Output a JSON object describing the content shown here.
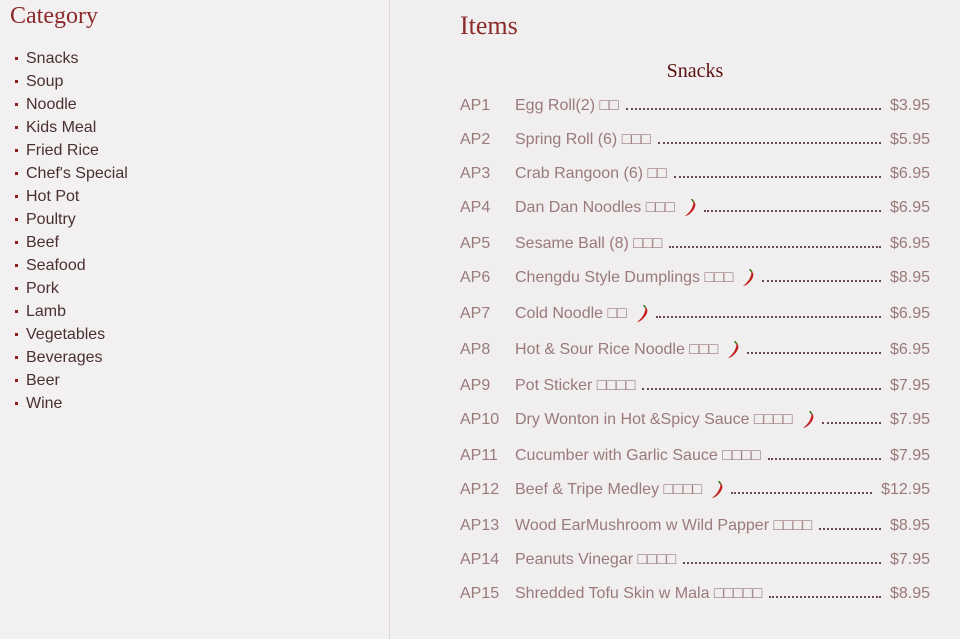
{
  "sidebar": {
    "title": "Category",
    "items": [
      "Snacks",
      "Soup",
      "Noodle",
      "Kids Meal",
      "Fried Rice",
      "Chef's Special",
      "Hot Pot",
      "Poultry",
      "Beef",
      "Seafood",
      "Pork",
      "Lamb",
      "Vegetables",
      "Beverages",
      "Beer",
      "Wine"
    ]
  },
  "main": {
    "title": "Items",
    "section": "Snacks",
    "items": [
      {
        "code": "AP1",
        "name": "Egg Roll(2) □□",
        "price": "$3.95",
        "spicy": false
      },
      {
        "code": "AP2",
        "name": "Spring Roll (6) □□□",
        "price": "$5.95",
        "spicy": false
      },
      {
        "code": "AP3",
        "name": "Crab Rangoon (6) □□",
        "price": "$6.95",
        "spicy": false
      },
      {
        "code": "AP4",
        "name": "Dan Dan Noodles □□□",
        "price": "$6.95",
        "spicy": true
      },
      {
        "code": "AP5",
        "name": "Sesame Ball (8) □□□",
        "price": "$6.95",
        "spicy": false
      },
      {
        "code": "AP6",
        "name": "Chengdu Style Dumplings □□□",
        "price": "$8.95",
        "spicy": true
      },
      {
        "code": "AP7",
        "name": "Cold Noodle □□",
        "price": "$6.95",
        "spicy": true
      },
      {
        "code": "AP8",
        "name": "Hot & Sour Rice Noodle □□□",
        "price": "$6.95",
        "spicy": true
      },
      {
        "code": "AP9",
        "name": "Pot Sticker □□□□",
        "price": "$7.95",
        "spicy": false
      },
      {
        "code": "AP10",
        "name": "Dry Wonton in Hot &Spicy Sauce □□□□",
        "price": "$7.95",
        "spicy": true
      },
      {
        "code": "AP11",
        "name": "Cucumber with Garlic Sauce □□□□",
        "price": "$7.95",
        "spicy": false
      },
      {
        "code": "AP12",
        "name": "Beef & Tripe Medley □□□□",
        "price": "$12.95",
        "spicy": true
      },
      {
        "code": "AP13",
        "name": "Wood EarMushroom w Wild Papper □□□□",
        "price": "$8.95",
        "spicy": false
      },
      {
        "code": "AP14",
        "name": "Peanuts Vinegar □□□□",
        "price": "$7.95",
        "spicy": false
      },
      {
        "code": "AP15",
        "name": "Shredded Tofu Skin w Mala □□□□□",
        "price": "$8.95",
        "spicy": false
      }
    ]
  },
  "colors": {
    "accent": "#8b2a2a",
    "chili": "#c41e1e"
  }
}
